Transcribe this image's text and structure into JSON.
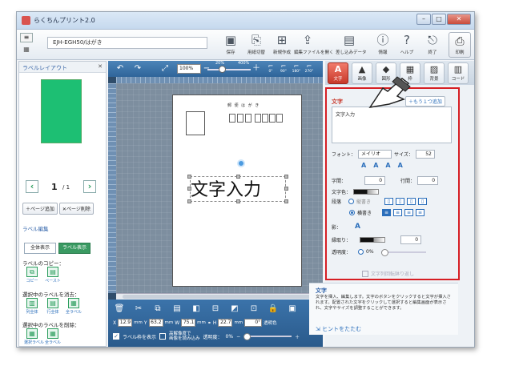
{
  "window": {
    "title": "らくちんプリント2.0"
  },
  "toolbar": {
    "doc_name": "EJH-EGH50/はがき",
    "items": [
      {
        "label": "保存",
        "icon": "save-icon",
        "glyph": "▣"
      },
      {
        "label": "用紙切替",
        "icon": "paper-switch-icon",
        "glyph": "⎘"
      },
      {
        "label": "新規作成",
        "icon": "new-doc-icon",
        "glyph": "⊞"
      },
      {
        "label": "編集ファイルを開く",
        "icon": "open-file-icon",
        "glyph": "⇪"
      },
      {
        "label": "差し込みデータ",
        "icon": "merge-data-icon",
        "glyph": "▤"
      },
      {
        "label": "情報",
        "icon": "info-icon",
        "glyph": "ⓘ"
      },
      {
        "label": "ヘルプ",
        "icon": "help-icon",
        "glyph": "?"
      },
      {
        "label": "終了",
        "icon": "exit-icon",
        "glyph": "⎋"
      }
    ],
    "print_label": "印刷"
  },
  "left_panel": {
    "title": "ラベルレイアウト",
    "page_current": "1",
    "page_total": "/ 1",
    "add_page": "ページ追加",
    "delete_page": "ページ削除",
    "label_edit": "ラベル編集",
    "show_all": "全体表示",
    "show_label": "ラベル表示",
    "copy_title": "ラベルのコピー：",
    "copy": "コピー",
    "paste": "ペースト",
    "clear_title": "選択中のラベルを消去：",
    "clear_items": [
      "列全体",
      "行全体",
      "全ラベル"
    ],
    "delete_title": "選択中のラベルを削除：",
    "delete_items": [
      "選択ラベル",
      "全ラベル"
    ]
  },
  "canvas": {
    "zoom": "100%",
    "zoom_min": "20%",
    "zoom_max": "400%",
    "rotations": [
      "0°",
      "90°",
      "180°",
      "270°"
    ],
    "postcard_header": "郵 便 は が き",
    "text": "文字入力"
  },
  "bottom": {
    "x": "12.9",
    "y": "63.2",
    "w": "75.1",
    "h": "22.7",
    "unit": "mm",
    "angle": "0°",
    "transparent_color": "透明色",
    "show_frame": "ラベル枠を表示",
    "hires_line1": "高解像度で",
    "hires_line2": "画像を読み込み",
    "opacity_label": "透明度：",
    "opacity_value": "0%"
  },
  "right_panel": {
    "tabs": [
      {
        "label": "文字",
        "glyph": "A"
      },
      {
        "label": "画像",
        "glyph": "▲"
      },
      {
        "label": "図形",
        "glyph": "◆"
      },
      {
        "label": "枠",
        "glyph": "▦"
      },
      {
        "label": "背景",
        "glyph": "▨"
      },
      {
        "label": "コード",
        "glyph": "▥"
      }
    ],
    "section_title": "文字",
    "add_one": "もう１つ追加",
    "text_value": "文字入力",
    "font_label": "フォント：",
    "font_value": "メイリオ",
    "size_label": "サイズ：",
    "size_value": "52",
    "char_spacing_label": "字間：",
    "char_spacing": "0",
    "line_spacing_label": "行間：",
    "line_spacing": "0",
    "text_color_label": "文字色：",
    "paragraph_label": "段落",
    "vertical": "縦書き",
    "horizontal": "横書き",
    "shadow_label": "影：",
    "outline_label": "縁取り：",
    "outline_value": "0",
    "opacity_label": "透明度：",
    "opacity_value": "0%",
    "rotate_label": "文字列回転鉢り返し"
  },
  "help": {
    "title": "文字",
    "body": "文字を挿入、編集します。文字のボタンをクリックすると文字が挿入されます。配置された文字をクリックして選択すると編集画面が表示され、文字やサイズを調整することができます。",
    "collapse": "ヒントをたたむ"
  },
  "colors": {
    "accent_red": "#d61e24",
    "toolbar_blue": "#2f659a",
    "green": "#2a9d5c"
  }
}
